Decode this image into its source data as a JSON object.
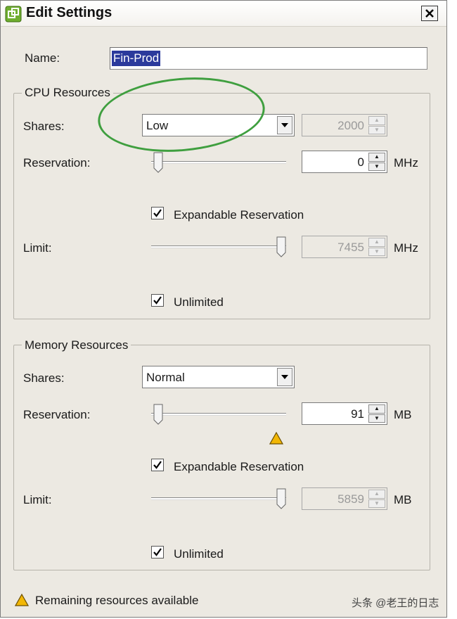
{
  "window": {
    "title": "Edit Settings"
  },
  "name": {
    "label": "Name:",
    "value": "Fin-Prod"
  },
  "cpu": {
    "title": "CPU Resources",
    "shares_label": "Shares:",
    "shares_value": "Low",
    "shares_count": "2000",
    "reservation_label": "Reservation:",
    "reservation_value": "0",
    "reservation_unit": "MHz",
    "reservation_slider_fraction": 0.0,
    "expandable_label": "Expandable Reservation",
    "expandable_checked": true,
    "limit_label": "Limit:",
    "limit_value": "7455",
    "limit_unit": "MHz",
    "limit_slider_fraction": 1.0,
    "unlimited_label": "Unlimited",
    "unlimited_checked": true
  },
  "memory": {
    "title": "Memory Resources",
    "shares_label": "Shares:",
    "shares_value": "Normal",
    "reservation_label": "Reservation:",
    "reservation_value": "91",
    "reservation_unit": "MB",
    "reservation_slider_fraction": 0.0,
    "expandable_label": "Expandable Reservation",
    "expandable_checked": true,
    "limit_label": "Limit:",
    "limit_value": "5859",
    "limit_unit": "MB",
    "limit_slider_fraction": 1.0,
    "unlimited_label": "Unlimited",
    "unlimited_checked": true
  },
  "footer": {
    "remaining_text": "Remaining resources available"
  },
  "watermark": "头条 @老王的日志",
  "colors": {
    "highlight": "#3f9f3f",
    "selection": "#2b3a9c",
    "warning": "#f2b705"
  },
  "icons": [
    "app-icon",
    "close-icon",
    "chevron-down-icon",
    "spin-up-icon",
    "spin-down-icon",
    "checkmark-icon",
    "warning-icon"
  ]
}
